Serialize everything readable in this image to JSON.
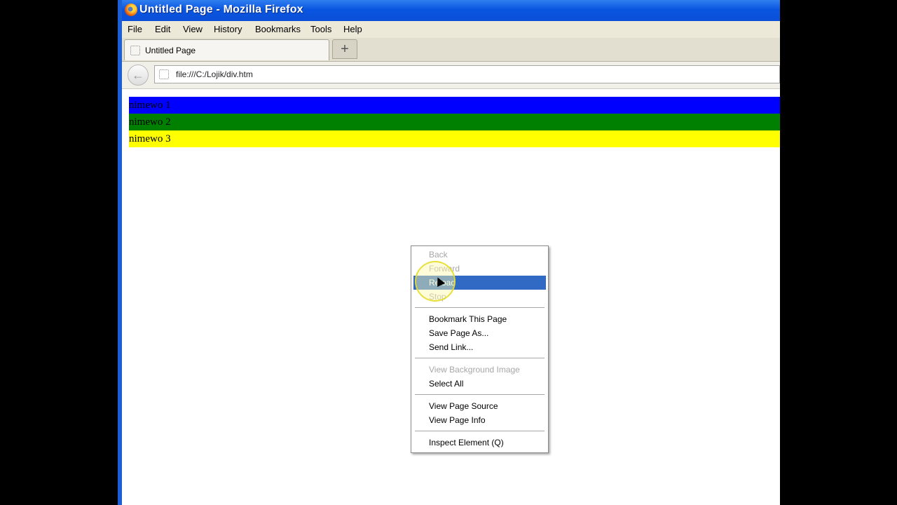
{
  "window": {
    "title": "Untitled Page - Mozilla Firefox"
  },
  "menubar": {
    "items": [
      "File",
      "Edit",
      "View",
      "History",
      "Bookmarks",
      "Tools",
      "Help"
    ]
  },
  "tabs": {
    "active_label": "Untitled Page",
    "new_tab_label": "+"
  },
  "navbar": {
    "back_glyph": "←",
    "url": "file:///C:/Lojik/div.htm"
  },
  "content": {
    "rows": [
      {
        "text": "nimewo 1",
        "color": "#0000ff"
      },
      {
        "text": "nimewo 2",
        "color": "#008000"
      },
      {
        "text": "nimewo 3",
        "color": "#ffff00"
      }
    ]
  },
  "context_menu": {
    "items": [
      {
        "label": "Back",
        "state": "disabled"
      },
      {
        "label": "Forward",
        "state": "disabled"
      },
      {
        "label": "Reload",
        "state": "selected"
      },
      {
        "label": "Stop",
        "state": "disabled"
      },
      {
        "label": "Bookmark This Page",
        "state": "enabled"
      },
      {
        "label": "Save Page As...",
        "state": "enabled"
      },
      {
        "label": "Send Link...",
        "state": "enabled"
      },
      {
        "label": "View Background Image",
        "state": "disabled"
      },
      {
        "label": "Select All",
        "state": "enabled"
      },
      {
        "label": "View Page Source",
        "state": "enabled"
      },
      {
        "label": "View Page Info",
        "state": "enabled"
      },
      {
        "label": "Inspect Element (Q)",
        "state": "enabled"
      }
    ],
    "selection_color": "#316ac5"
  },
  "icons": {
    "app": "firefox-icon",
    "back": "back-arrow-icon",
    "favicon": "page-favicon-icon"
  }
}
